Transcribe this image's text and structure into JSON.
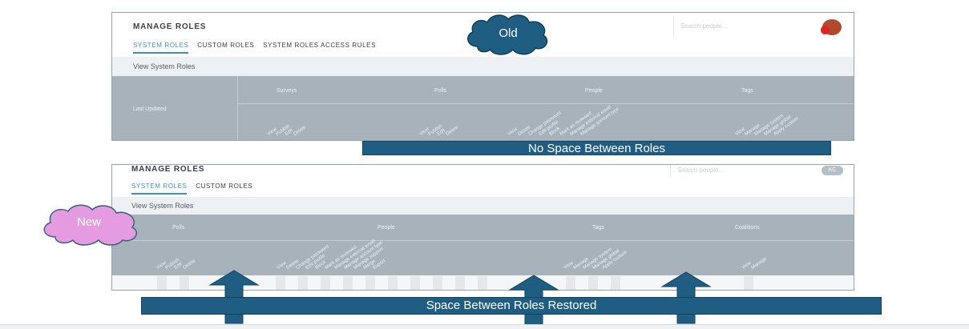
{
  "old_panel": {
    "title": "MANAGE ROLES",
    "search_placeholder": "Search people...",
    "tabs": [
      "SYSTEM ROLES",
      "CUSTOM ROLES",
      "SYSTEM ROLES ACCESS RULES"
    ],
    "subheader": "View System Roles",
    "row_label": "Last Updated",
    "columns": [
      "Surveys",
      "Polls",
      "People",
      "Tags"
    ],
    "permissions": {
      "surveys": [
        "View",
        "Publish",
        "Edit",
        "Delete"
      ],
      "polls": [
        "View",
        "Publish",
        "Edit",
        "Delete"
      ],
      "people": [
        "View",
        "Delete",
        "Change password",
        "Edit profile",
        "Block",
        "Mark as reviewed",
        "Manage external email",
        "Manage account type"
      ],
      "tags": [
        "View",
        "Manage",
        "Manage system",
        "Manage global",
        "Apply custom"
      ]
    }
  },
  "new_panel": {
    "title": "MANAGE ROLES",
    "search_placeholder": "Search people...",
    "avatar_initials": "KC",
    "tabs": [
      "SYSTEM ROLES",
      "CUSTOM ROLES"
    ],
    "subheader": "View System Roles",
    "columns": [
      "Polls",
      "People",
      "Tags",
      "Coalitions"
    ],
    "permissions": {
      "polls": [
        "View",
        "Publish",
        "Edit",
        "Delete"
      ],
      "people": [
        "View",
        "Delete",
        "Change password",
        "Edit profile",
        "Block",
        "Mark as reviewed",
        "Manage external email",
        "Manage account type",
        "Manage support",
        "Merge",
        "Export"
      ],
      "tags": [
        "View",
        "Manage",
        "Manage system",
        "Manage global",
        "Apply custom"
      ],
      "coalitions": [
        "View",
        "Manage"
      ]
    }
  },
  "callouts": {
    "old": "Old",
    "new": "New",
    "top_banner": "No Space Between Roles",
    "bottom_banner": "Space Between Roles Restored"
  },
  "colors": {
    "banner": "#1f5e82",
    "old_cloud": "#1f5e82",
    "new_cloud": "#e59be0",
    "grid": "#a7b2bb",
    "active_tab": "#3b8fd1"
  }
}
